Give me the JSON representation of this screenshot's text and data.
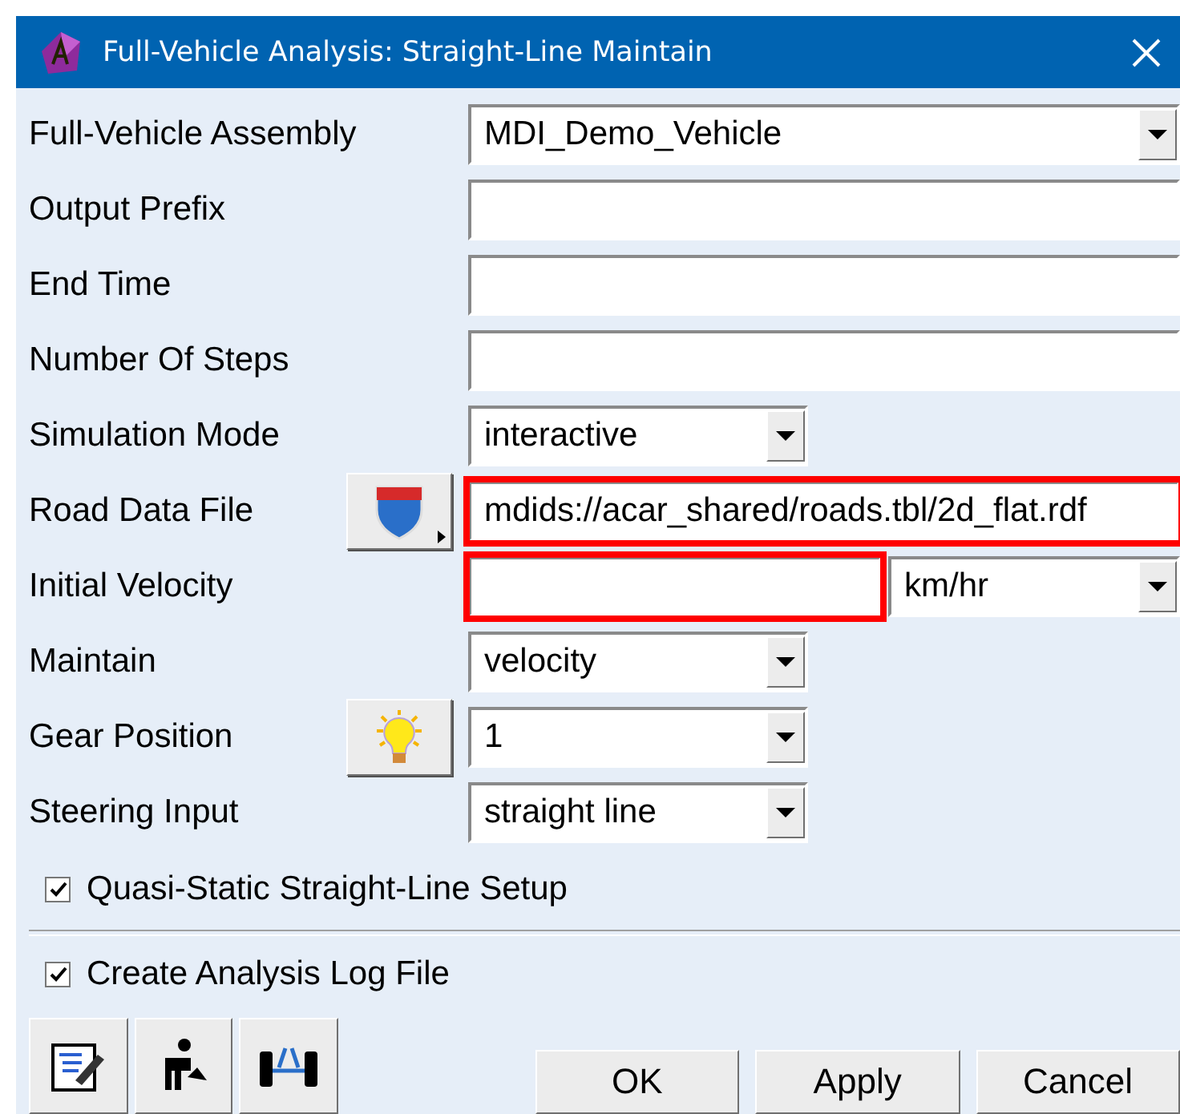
{
  "window": {
    "title": "Full-Vehicle Analysis: Straight-Line Maintain"
  },
  "rows": [
    {
      "label": "Full-Vehicle Assembly",
      "kind": "combo-wide",
      "value": "MDI_Demo_Vehicle"
    },
    {
      "label": "Output Prefix",
      "kind": "text"
    },
    {
      "label": "End Time",
      "kind": "text"
    },
    {
      "label": "Number Of Steps",
      "kind": "text"
    },
    {
      "label": "Simulation Mode",
      "kind": "combo",
      "value": "interactive"
    },
    {
      "label": "Road Data File",
      "kind": "text",
      "button": {
        "kind": "road-sign"
      },
      "value": "mdids://acar_shared/roads.tbl/2d_flat.rdf",
      "highlighted": true
    },
    {
      "label": "Initial Velocity",
      "kind": "text-unit",
      "unit": "km/hr",
      "highlighted": true
    },
    {
      "label": "Maintain",
      "kind": "combo",
      "value": "velocity"
    },
    {
      "label": "Gear Position",
      "kind": "combo",
      "button": {
        "kind": "bulb"
      },
      "value": "1"
    },
    {
      "label": "Steering Input",
      "kind": "combo",
      "value": "straight line"
    }
  ],
  "options": [
    {
      "label": "Quasi-Static Straight-Line Setup",
      "checked": true
    }
  ],
  "log_option": {
    "label": "Create Analysis Log File",
    "checked": true
  },
  "buttons": [
    "OK",
    "Apply",
    "Cancel"
  ]
}
